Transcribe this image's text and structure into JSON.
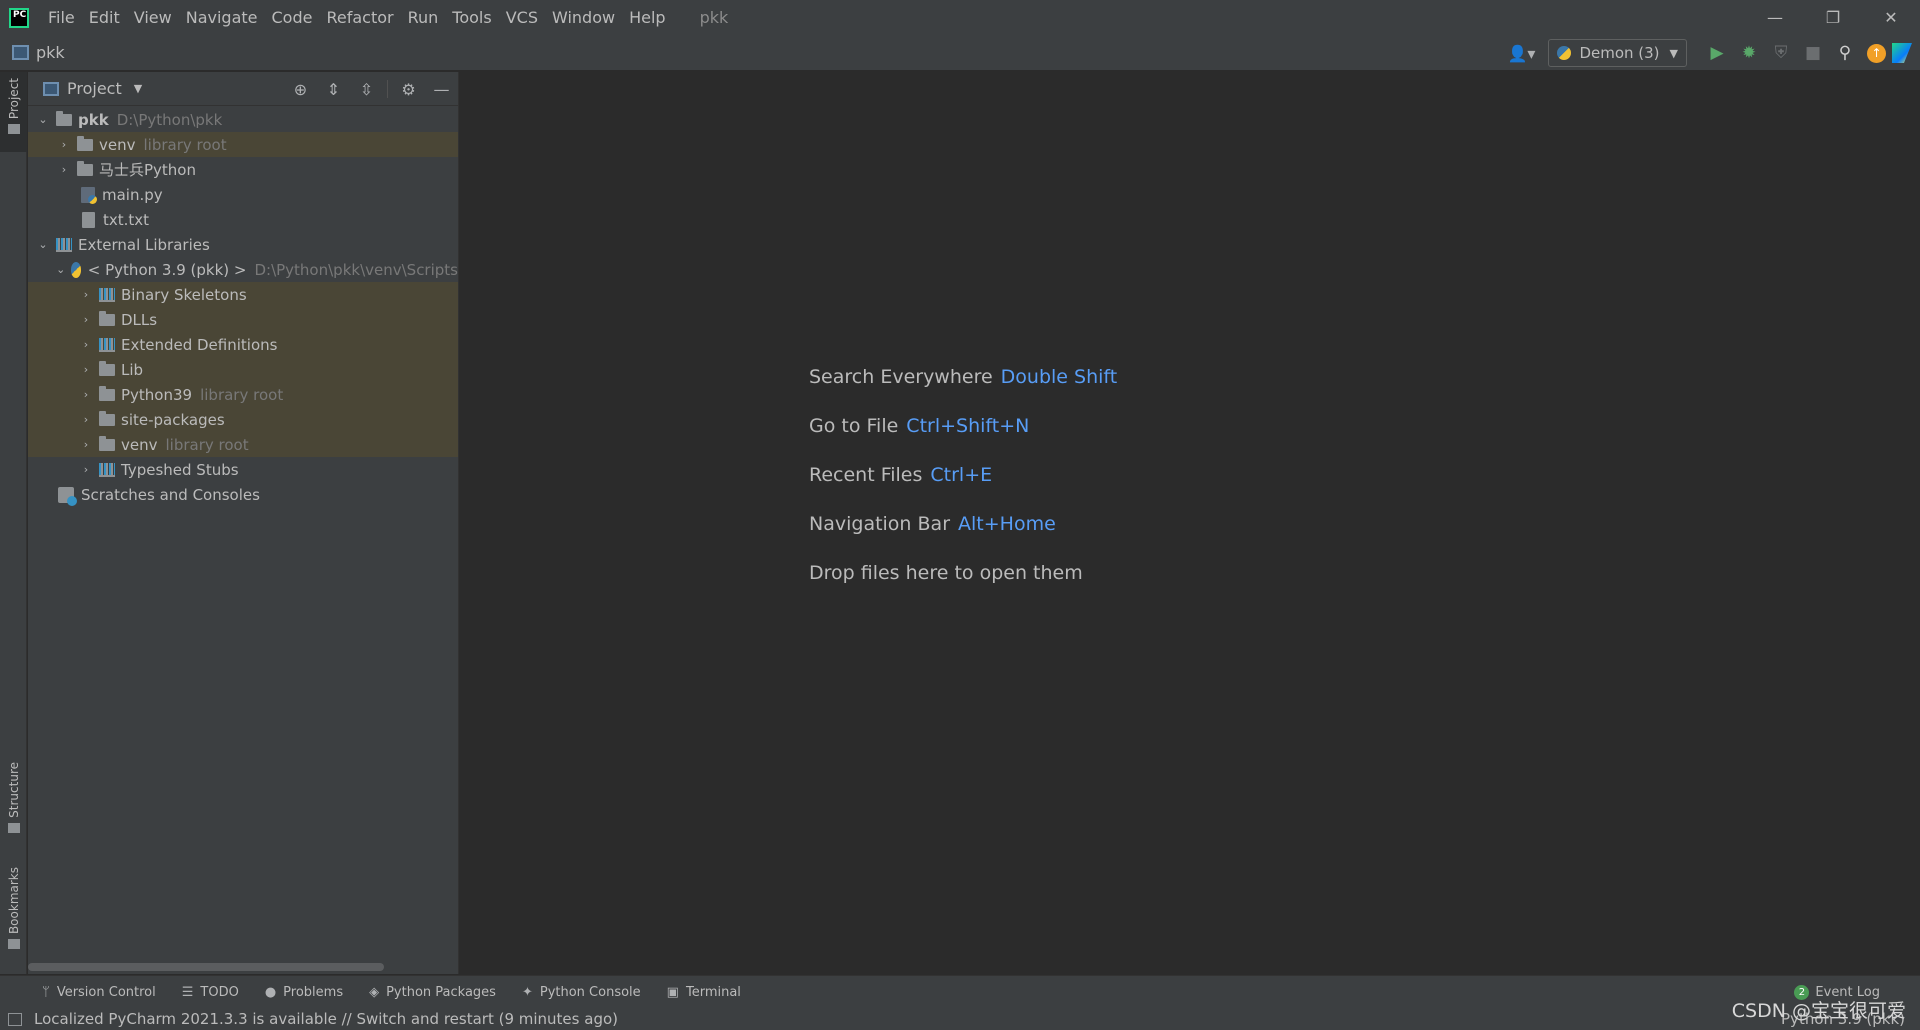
{
  "titlebar": {
    "menu": [
      "File",
      "Edit",
      "View",
      "Navigate",
      "Code",
      "Refactor",
      "Run",
      "Tools",
      "VCS",
      "Window",
      "Help"
    ],
    "title": "pkk",
    "controls": {
      "minimize": "—",
      "restore": "❐",
      "close": "✕"
    }
  },
  "navbar": {
    "project": "pkk",
    "run_config": "Demon (3)"
  },
  "left_stripe": {
    "project": "Project",
    "structure": "Structure",
    "bookmarks": "Bookmarks"
  },
  "project_panel": {
    "title": "Project",
    "tree": [
      {
        "name": "pkk",
        "hint": "D:\\Python\\pkk"
      },
      {
        "name": "venv",
        "hint": "library root"
      },
      {
        "name": "马士兵Python"
      },
      {
        "name": "main.py"
      },
      {
        "name": "txt.txt"
      },
      {
        "name": "External Libraries"
      },
      {
        "name": "< Python 3.9 (pkk) >",
        "hint": "D:\\Python\\pkk\\venv\\Scripts"
      },
      {
        "name": "Binary Skeletons"
      },
      {
        "name": "DLLs"
      },
      {
        "name": "Extended Definitions"
      },
      {
        "name": "Lib"
      },
      {
        "name": "Python39",
        "hint": "library root"
      },
      {
        "name": "site-packages"
      },
      {
        "name": "venv",
        "hint": "library root"
      },
      {
        "name": "Typeshed Stubs"
      },
      {
        "name": "Scratches and Consoles"
      }
    ]
  },
  "editor": {
    "welcome": [
      {
        "label": "Search Everywhere",
        "shortcut": "Double Shift"
      },
      {
        "label": "Go to File",
        "shortcut": "Ctrl+Shift+N"
      },
      {
        "label": "Recent Files",
        "shortcut": "Ctrl+E"
      },
      {
        "label": "Navigation Bar",
        "shortcut": "Alt+Home"
      },
      {
        "label": "Drop files here to open them",
        "shortcut": ""
      }
    ]
  },
  "bottom_bar": {
    "tabs": [
      "Version Control",
      "TODO",
      "Problems",
      "Python Packages",
      "Python Console",
      "Terminal"
    ],
    "event_log": "Event Log",
    "event_count": "2"
  },
  "status_bar": {
    "message": "Localized PyCharm 2021.3.3 is available // Switch and restart (9 minutes ago)",
    "interpreter": "Python 3.9 (pkk)"
  },
  "watermark": "CSDN @宝宝很可爱",
  "colors": {
    "accent": "#589df6",
    "library_bg": "#4a4636",
    "panel_bg": "#3c3f41",
    "editor_bg": "#2b2b2b"
  }
}
